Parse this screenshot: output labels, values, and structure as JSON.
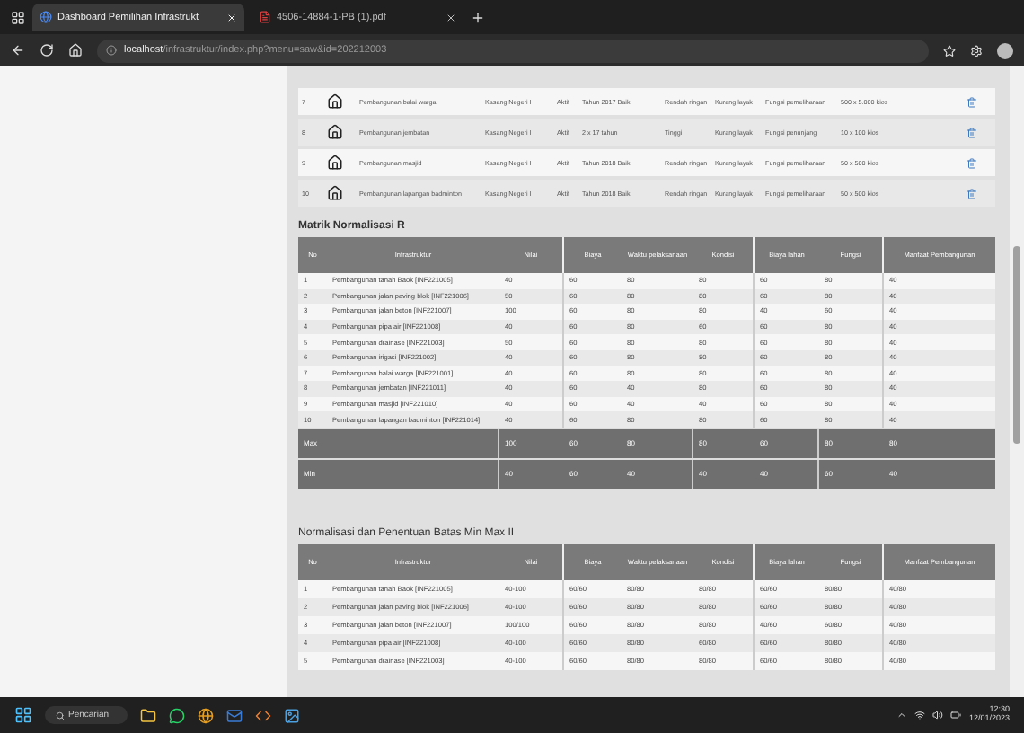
{
  "browser": {
    "tabs": [
      {
        "title": "Dashboard Pemilihan Infrastrukt",
        "kind": "site",
        "selected": true
      },
      {
        "title": "4506-14884-1-PB (1).pdf",
        "kind": "pdf",
        "selected": false
      }
    ],
    "address": {
      "host": "localhost",
      "path": "/infrastruktur/index.php?menu=saw&id=202212003"
    }
  },
  "facilities": [
    {
      "no": "7",
      "name": "Pembangunan balai warga",
      "location": "Kasang Negeri I",
      "status": "Aktif",
      "year": "Tahun 2017 Baik",
      "cost": "Rendah ringan",
      "condition": "Kurang layak",
      "function": "Fungsi pemeliharaan",
      "size": "500 x 5.000 kios"
    },
    {
      "no": "8",
      "name": "Pembangunan jembatan",
      "location": "Kasang Negeri I",
      "status": "Aktif",
      "year": "2 x 17 tahun",
      "cost": "Tinggi",
      "condition": "Kurang layak",
      "function": "Fungsi penunjang",
      "size": "10 x 100 kios"
    },
    {
      "no": "9",
      "name": "Pembangunan masjid",
      "location": "Kasang Negeri I",
      "status": "Aktif",
      "year": "Tahun 2018 Baik",
      "cost": "Rendah ringan",
      "condition": "Kurang layak",
      "function": "Fungsi pemeliharaan",
      "size": "50 x 500 kios"
    },
    {
      "no": "10",
      "name": "Pembangunan lapangan badminton",
      "location": "Kasang Negeri I",
      "status": "Aktif",
      "year": "Tahun 2018 Baik",
      "cost": "Rendah ringan",
      "condition": "Kurang layak",
      "function": "Fungsi pemeliharaan",
      "size": "50 x 500 kios"
    }
  ],
  "matrix": {
    "title": "Matrik Normalisasi R",
    "columns": [
      "No",
      "Infrastruktur",
      "Nilai",
      "Biaya",
      "Waktu pelaksanaan",
      "Kondisi",
      "Biaya lahan",
      "Fungsi",
      "Manfaat Pembangunan"
    ],
    "rows": [
      [
        "1",
        "Pembangunan tanah Baok [INF221005]",
        "40",
        "60",
        "80",
        "80",
        "60",
        "80",
        "40"
      ],
      [
        "2",
        "Pembangunan jalan paving blok [INF221006]",
        "50",
        "60",
        "80",
        "80",
        "60",
        "80",
        "40"
      ],
      [
        "3",
        "Pembangunan jalan beton [INF221007]",
        "100",
        "60",
        "80",
        "80",
        "40",
        "60",
        "40"
      ],
      [
        "4",
        "Pembangunan pipa air [INF221008]",
        "40",
        "60",
        "80",
        "60",
        "60",
        "80",
        "40"
      ],
      [
        "5",
        "Pembangunan drainase [INF221003]",
        "50",
        "60",
        "80",
        "80",
        "60",
        "80",
        "40"
      ],
      [
        "6",
        "Pembangunan irigasi [INF221002]",
        "40",
        "60",
        "80",
        "80",
        "60",
        "80",
        "40"
      ],
      [
        "7",
        "Pembangunan balai warga [INF221001]",
        "40",
        "60",
        "80",
        "80",
        "60",
        "80",
        "40"
      ],
      [
        "8",
        "Pembangunan jembatan [INF221011]",
        "40",
        "60",
        "40",
        "80",
        "60",
        "80",
        "40"
      ],
      [
        "9",
        "Pembangunan masjid [INF221010]",
        "40",
        "60",
        "40",
        "40",
        "60",
        "80",
        "40"
      ],
      [
        "10",
        "Pembangunan lapangan badminton [INF221014]",
        "40",
        "60",
        "80",
        "80",
        "60",
        "80",
        "40"
      ]
    ],
    "summary": [
      [
        "Max",
        "100",
        "60",
        "80",
        "80",
        "60",
        "80",
        "80"
      ],
      [
        "Min",
        "40",
        "60",
        "40",
        "40",
        "40",
        "60",
        "40"
      ]
    ]
  },
  "normalization": {
    "title": "Normalisasi dan Penentuan Batas Min Max II",
    "columns": [
      "No",
      "Infrastruktur",
      "Nilai",
      "Biaya",
      "Waktu pelaksanaan",
      "Kondisi",
      "Biaya lahan",
      "Fungsi",
      "Manfaat Pembangunan"
    ],
    "rows": [
      [
        "1",
        "Pembangunan tanah Baok [INF221005]",
        "40-100",
        "60/60",
        "80/80",
        "80/80",
        "60/60",
        "80/80",
        "40/80"
      ],
      [
        "2",
        "Pembangunan jalan paving blok [INF221006]",
        "40-100",
        "60/60",
        "80/80",
        "80/80",
        "60/60",
        "80/80",
        "40/80"
      ],
      [
        "3",
        "Pembangunan jalan beton [INF221007]",
        "100/100",
        "60/60",
        "80/80",
        "80/80",
        "40/60",
        "60/80",
        "40/80"
      ],
      [
        "4",
        "Pembangunan pipa air [INF221008]",
        "40-100",
        "60/60",
        "80/80",
        "60/80",
        "60/60",
        "80/80",
        "40/80"
      ],
      [
        "5",
        "Pembangunan drainase [INF221003]",
        "40-100",
        "60/60",
        "80/80",
        "80/80",
        "60/60",
        "80/80",
        "40/80"
      ]
    ]
  },
  "taskbar": {
    "search": "Pencarian",
    "time": "12:30",
    "date": "12/01/2023"
  }
}
